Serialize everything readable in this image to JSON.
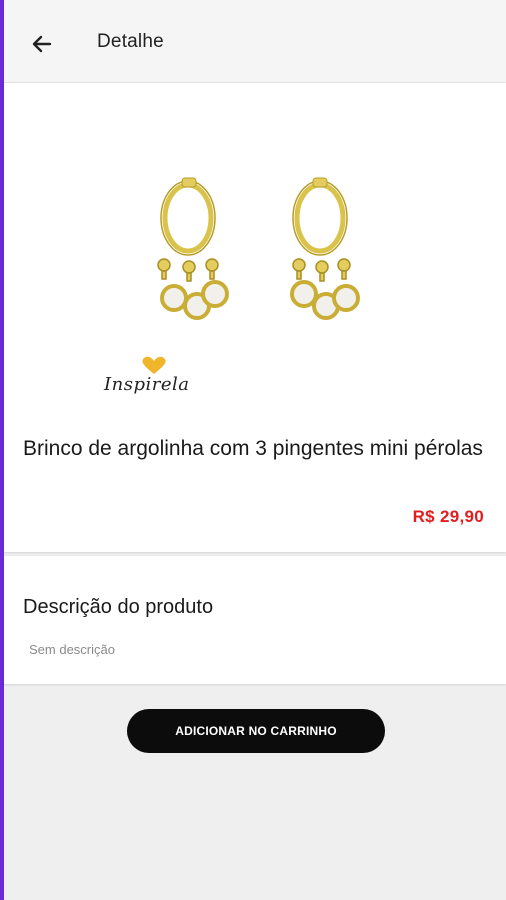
{
  "appbar": {
    "title": "Detalhe",
    "back_icon": "arrow-left-icon"
  },
  "product": {
    "brand": "Inspirela",
    "name": "Brinco de argolinha com 3 pingentes mini pérolas",
    "price": "R$ 29,90"
  },
  "description": {
    "title": "Descrição do produto",
    "text": "Sem descrição"
  },
  "actions": {
    "add_to_cart_label": "ADICIONAR NO CARRINHO"
  },
  "colors": {
    "price": "#e11d1d",
    "button": "#0c0c0c",
    "accent_edge": "#6a2bd6",
    "gold": "#d9c34a"
  }
}
